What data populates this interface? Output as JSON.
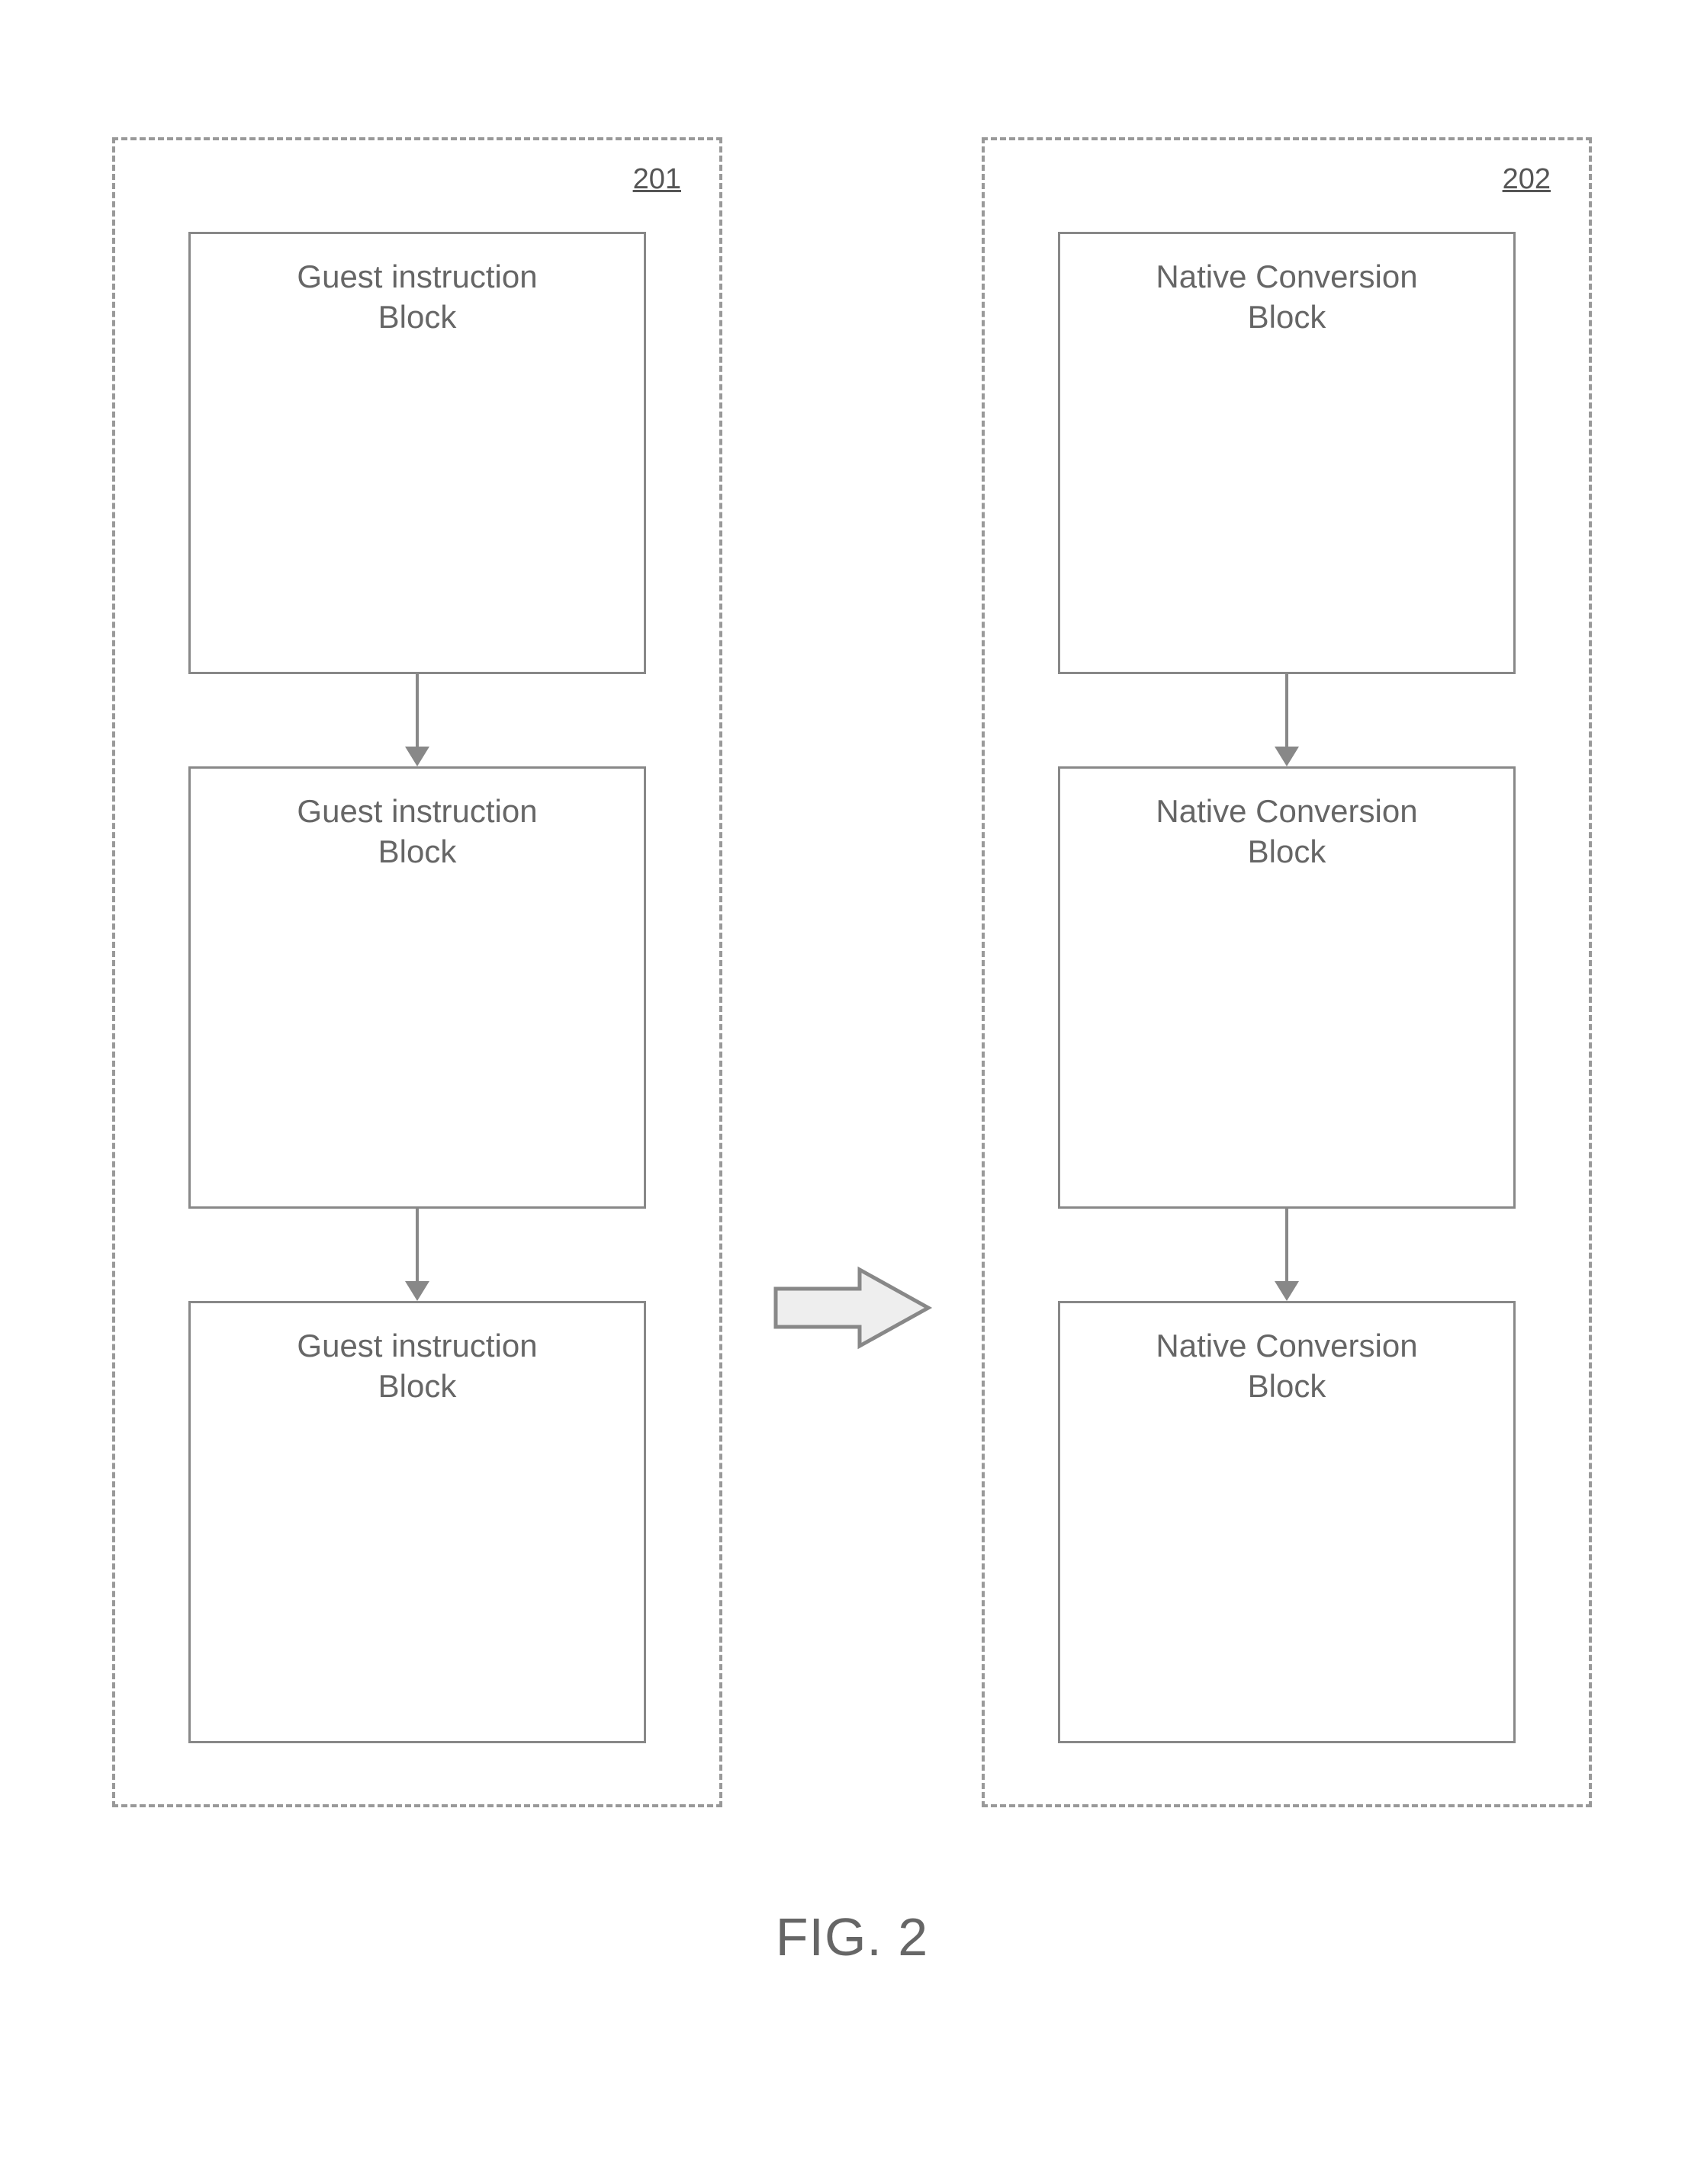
{
  "left": {
    "id": "201",
    "blocks": [
      {
        "line1": "Guest instruction",
        "line2": "Block"
      },
      {
        "line1": "Guest instruction",
        "line2": "Block"
      },
      {
        "line1": "Guest instruction",
        "line2": "Block"
      }
    ]
  },
  "right": {
    "id": "202",
    "blocks": [
      {
        "line1": "Native Conversion",
        "line2": "Block"
      },
      {
        "line1": "Native Conversion",
        "line2": "Block"
      },
      {
        "line1": "Native Conversion",
        "line2": "Block"
      }
    ]
  },
  "caption": "FIG. 2"
}
